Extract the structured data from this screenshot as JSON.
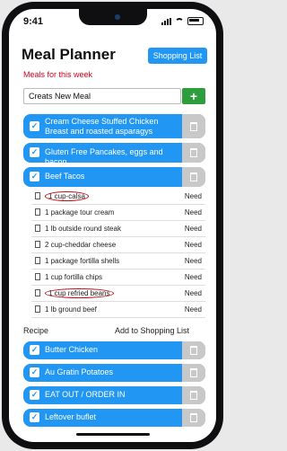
{
  "status": {
    "time": "9:41"
  },
  "header": {
    "title": "Meal Planner",
    "shopping_list_button": "Shopping List"
  },
  "subtitle": "Meals for this week",
  "new_meal": {
    "value": "Creats New Meal",
    "add_label": "+"
  },
  "meals_top": [
    {
      "label": "Cream Cheese Stuffed Chicken Breast and roasted asparagys"
    },
    {
      "label": "Gluten Free Pancakes, eggs and bacon"
    },
    {
      "label": "Beef Tacos"
    }
  ],
  "ingredients": [
    {
      "name": "1 cup-calsa",
      "status": "Need",
      "circled": true
    },
    {
      "name": "1 package tour cream",
      "status": "Need"
    },
    {
      "name": "1 lb outside round steak",
      "status": "Need"
    },
    {
      "name": "2 cup-cheddar cheese",
      "status": "Need"
    },
    {
      "name": "1 package fortilla shells",
      "status": "Need"
    },
    {
      "name": "1 cup fortilla chips",
      "status": "Need"
    },
    {
      "name": "1 cup refried beans",
      "status": "Need",
      "circled": true
    },
    {
      "name": "1 lb ground beef",
      "status": "Need"
    }
  ],
  "recipe_row": {
    "recipe": "Recipe",
    "add_to_list": "Add to Shopping List"
  },
  "meals_bottom": [
    {
      "label": "Butter Chicken"
    },
    {
      "label": "Au Gratin Potatoes"
    },
    {
      "label": "EAT OUT / ORDER IN"
    },
    {
      "label": "Leftover buflet"
    }
  ],
  "colors": {
    "accent": "#2196f3",
    "add_green": "#2e9e3c",
    "subtitle_red": "#d0021b",
    "trash_gray": "#c8c8c8"
  }
}
